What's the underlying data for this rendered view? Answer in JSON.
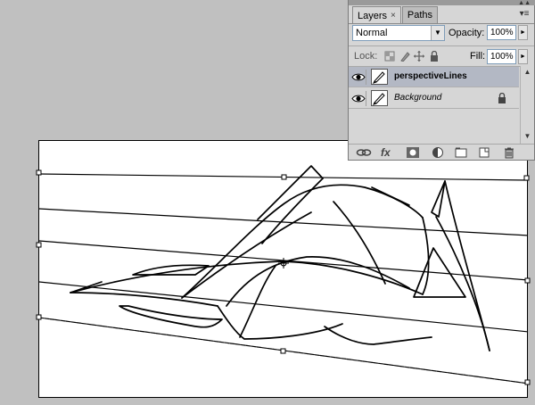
{
  "panel": {
    "tabs": [
      {
        "label": "Layers",
        "active": true
      },
      {
        "label": "Paths",
        "active": false
      }
    ],
    "blend_mode": "Normal",
    "opacity_label": "Opacity:",
    "opacity_value": "100%",
    "lock_label": "Lock:",
    "fill_label": "Fill:",
    "fill_value": "100%",
    "layers": [
      {
        "name": "perspectiveLines",
        "selected": true,
        "visible": true,
        "locked": false
      },
      {
        "name": "Background",
        "selected": false,
        "visible": true,
        "locked": true
      }
    ],
    "bottom_icons": [
      "link-layers-icon",
      "fx-icon",
      "layer-mask-icon",
      "adjustment-layer-icon",
      "new-group-icon",
      "new-layer-icon",
      "delete-layer-icon"
    ],
    "fx_glyph": "fx"
  },
  "colors": {
    "workspace": "#c0c0c0",
    "panel_bg": "#d6d6d6",
    "selected_row": "#b3b8c4",
    "canvas": "#ffffff"
  },
  "icons": {
    "tab_close": "×",
    "menu": "▾≡",
    "collapse": "▲▲",
    "dropdown": "▼",
    "flyout": "►",
    "scroll_up": "▲",
    "scroll_down": "▼"
  }
}
